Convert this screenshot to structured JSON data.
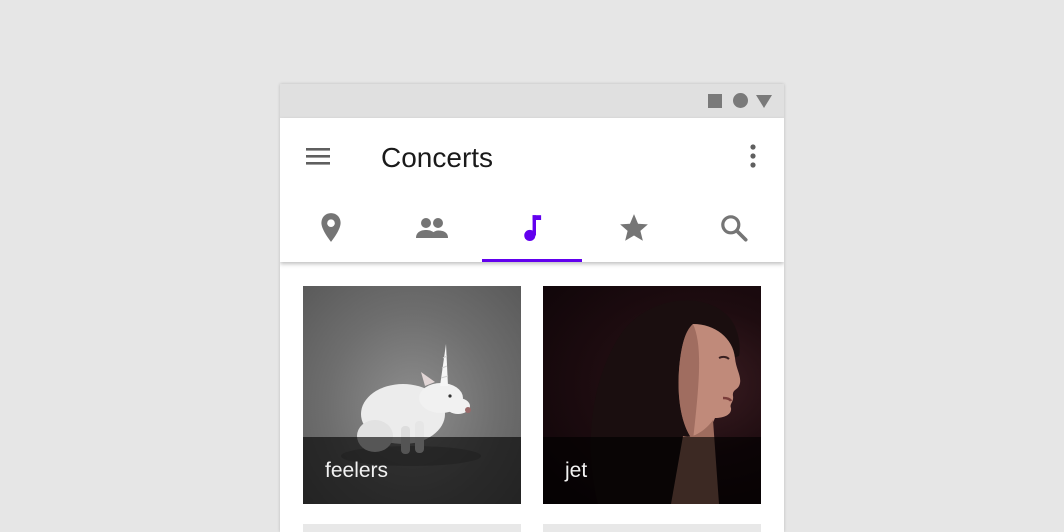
{
  "header": {
    "title": "Concerts"
  },
  "tabs": [
    {
      "name": "location",
      "icon": "location-pin-icon",
      "selected": false
    },
    {
      "name": "people",
      "icon": "people-icon",
      "selected": false
    },
    {
      "name": "music",
      "icon": "music-note-icon",
      "selected": true
    },
    {
      "name": "favorites",
      "icon": "star-icon",
      "selected": false
    },
    {
      "name": "search",
      "icon": "search-icon",
      "selected": false
    }
  ],
  "cards": [
    {
      "label": "feelers",
      "image": "unicorn-dog-photo"
    },
    {
      "label": "jet",
      "image": "woman-profile-photo"
    }
  ],
  "colors": {
    "accent": "#6200ee",
    "icon_gray": "#757575",
    "status_bar": "#e0e0e0",
    "background": "#e6e6e6"
  }
}
